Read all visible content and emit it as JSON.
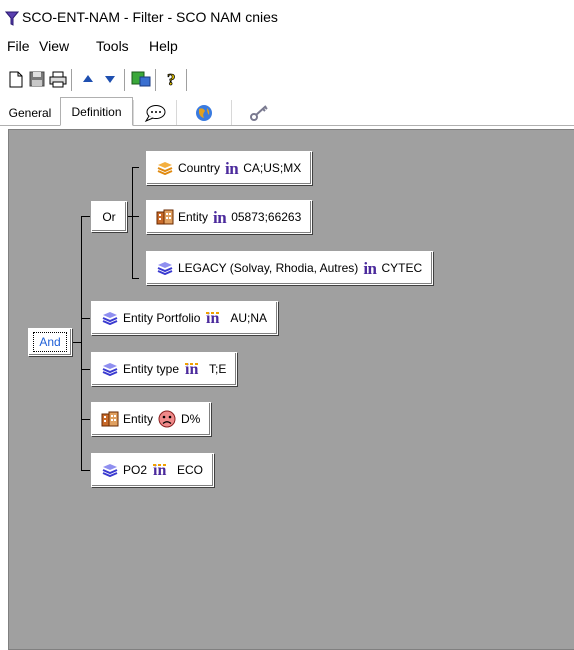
{
  "window": {
    "title": "SCO-ENT-NAM - Filter - SCO NAM cnies"
  },
  "menu": [
    "File",
    "View",
    "Tools",
    "Help"
  ],
  "toolbar": {
    "buttons": [
      "new-document-icon",
      "save-icon",
      "print-icon",
      "move-up-icon",
      "move-down-icon",
      "export-icon",
      "help-icon"
    ]
  },
  "tabs": {
    "general": "General",
    "definition": "Definition",
    "comment_icon": "speech-bubble-icon",
    "globe_icon": "globe-icon",
    "key_icon": "key-icon"
  },
  "tree": {
    "and_label": "And",
    "or_label": "Or",
    "in_op": "in",
    "nodes": [
      {
        "field": "Country",
        "op": "in",
        "value": "CA;US;MX",
        "icon": "layers-orange-icon"
      },
      {
        "field": "Entity",
        "op": "in",
        "value": "05873;66263",
        "icon": "building-icon"
      },
      {
        "field": "LEGACY (Solvay, Rhodia, Autres)",
        "op": "in",
        "value": "CYTEC",
        "icon": "layers-blue-icon"
      },
      {
        "field": "Entity Portfolio",
        "op": "in",
        "value": "AU;NA",
        "icon": "layers-blue-icon"
      },
      {
        "field": "Entity type",
        "op": "in",
        "value": "T;E",
        "icon": "layers-blue-icon"
      },
      {
        "field": "Entity",
        "op": "not-like",
        "value": "D%",
        "icon": "building-icon"
      },
      {
        "field": "PO2",
        "op": "in",
        "value": "ECO",
        "icon": "layers-blue-icon"
      }
    ]
  },
  "colors": {
    "canvas": "#a0a0a0",
    "selection_text": "#1e5fd8",
    "in_operator": "#4b2a9c"
  }
}
